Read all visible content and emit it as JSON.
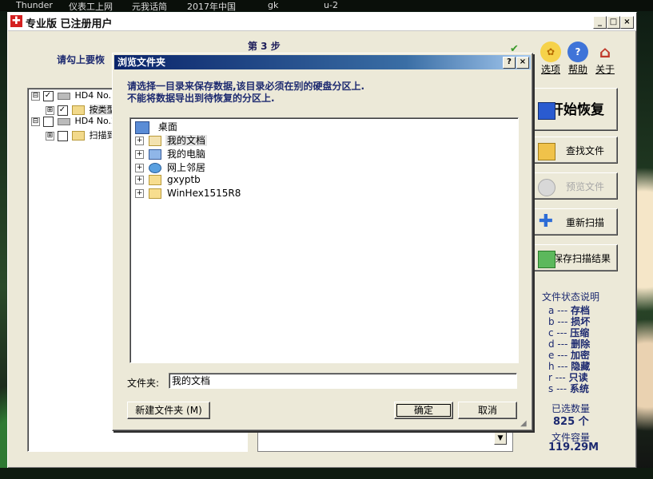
{
  "topbar": {
    "items": [
      "Thunder",
      "仪表工上网",
      "元我话简",
      "2017年中国",
      "gk",
      "u-2"
    ]
  },
  "main_window": {
    "title": "专业版  已注册用户",
    "logo": "✚",
    "controls": [
      "_",
      "□",
      "×"
    ],
    "step_label": "第 3 步",
    "hint_text": "请勾上要恢",
    "toolbar": [
      {
        "label": "选项",
        "icon": "gear-icon"
      },
      {
        "label": "帮助",
        "icon": "help-icon"
      },
      {
        "label": "关于",
        "icon": "home-icon"
      }
    ],
    "tree": [
      {
        "text": "HD4 No.1 [",
        "checked": true,
        "level": 0,
        "type": "drive",
        "expander": "⊟"
      },
      {
        "text": "按类型",
        "checked": true,
        "level": 1,
        "type": "folder",
        "expander": "⊞"
      },
      {
        "text": "HD4 No.2 [",
        "checked": false,
        "level": 0,
        "type": "drive",
        "expander": "⊟"
      },
      {
        "text": "扫描到",
        "checked": false,
        "level": 1,
        "type": "folder",
        "expander": "⊞"
      }
    ],
    "buttons": {
      "start_recovery": "开始恢复",
      "find_files": "查找文件",
      "preview_file": "预览文件",
      "rescan": "重新扫描",
      "save_scan_results": "保存扫描结果"
    },
    "legend": {
      "title": "文件状态说明",
      "rows": [
        {
          "key": "a ---",
          "value": "存档"
        },
        {
          "key": "b ---",
          "value": "损坏"
        },
        {
          "key": "c ---",
          "value": "压缩"
        },
        {
          "key": "d ---",
          "value": "删除"
        },
        {
          "key": "e ---",
          "value": "加密"
        },
        {
          "key": "h ---",
          "value": "隐藏"
        },
        {
          "key": "r ---",
          "value": "只读"
        },
        {
          "key": "s ---",
          "value": "系统"
        }
      ]
    },
    "stats": {
      "selected_label": "已选数量",
      "selected_value": "825 个",
      "size_label": "文件容量",
      "size_value": "119.29M"
    }
  },
  "dialog": {
    "title": "浏览文件夹",
    "help_btn": "?",
    "close_btn": "×",
    "instruction_line1": "请选择一目录来保存数据,该目录必须在别的硬盘分区上.",
    "instruction_line2": "不能将数据导出到待恢复的分区上.",
    "tree": {
      "root": "桌面",
      "items": [
        {
          "label": "我的文档",
          "selected": true,
          "icon": "documents-folder-icon"
        },
        {
          "label": "我的电脑",
          "selected": false,
          "icon": "computer-icon"
        },
        {
          "label": "网上邻居",
          "selected": false,
          "icon": "network-icon"
        },
        {
          "label": "gxyptb",
          "selected": false,
          "icon": "folder-icon"
        },
        {
          "label": "WinHex1515R8",
          "selected": false,
          "icon": "folder-icon"
        }
      ]
    },
    "folder_label": "文件夹:",
    "folder_value": "我的文档",
    "new_folder_button": "新建文件夹 (M)",
    "ok_button": "确定",
    "cancel_button": "取消"
  }
}
